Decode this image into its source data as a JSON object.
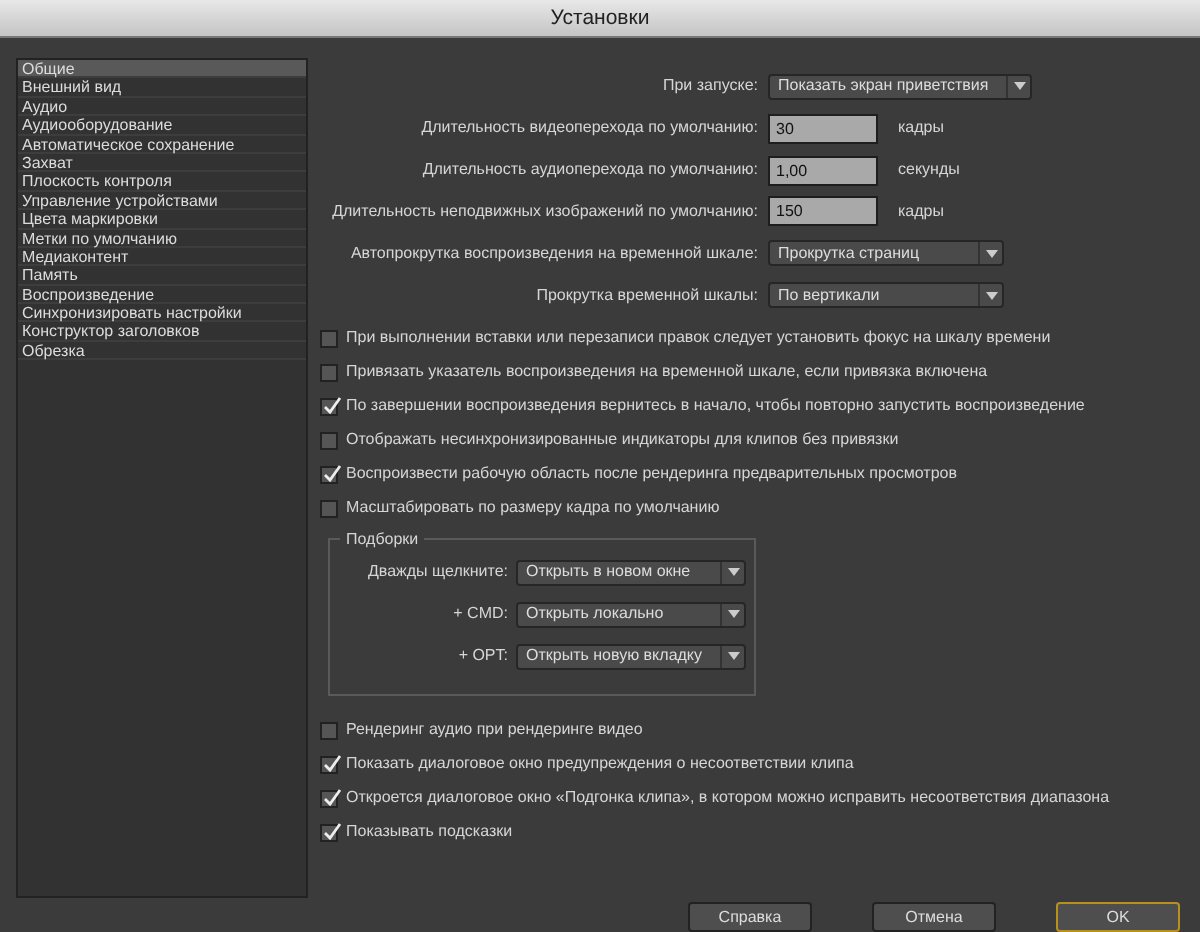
{
  "window": {
    "title": "Установки"
  },
  "sidebar": {
    "items": [
      {
        "label": "Общие",
        "selected": true
      },
      {
        "label": "Внешний вид",
        "selected": false
      },
      {
        "label": "Аудио",
        "selected": false
      },
      {
        "label": "Аудиооборудование",
        "selected": false
      },
      {
        "label": "Автоматическое сохранение",
        "selected": false
      },
      {
        "label": "Захват",
        "selected": false
      },
      {
        "label": "Плоскость контроля",
        "selected": false
      },
      {
        "label": "Управление устройствами",
        "selected": false
      },
      {
        "label": "Цвета маркировки",
        "selected": false
      },
      {
        "label": "Метки по умолчанию",
        "selected": false
      },
      {
        "label": "Медиаконтент",
        "selected": false
      },
      {
        "label": "Память",
        "selected": false
      },
      {
        "label": "Воспроизведение",
        "selected": false
      },
      {
        "label": "Синхронизировать настройки",
        "selected": false
      },
      {
        "label": "Конструктор заголовков",
        "selected": false
      },
      {
        "label": "Обрезка",
        "selected": false
      }
    ]
  },
  "settings": [
    {
      "kind": "dropdown",
      "label": "При запуске:",
      "value": "Показать экран приветствия"
    },
    {
      "kind": "number",
      "label": "Длительность видеоперехода по умолчанию:",
      "value": "30",
      "unit": "кадры"
    },
    {
      "kind": "number",
      "label": "Длительность аудиоперехода по умолчанию:",
      "value": "1,00",
      "unit": "секунды"
    },
    {
      "kind": "number",
      "label": "Длительность неподвижных изображений по умолчанию:",
      "value": "150",
      "unit": "кадры"
    },
    {
      "kind": "dropdown",
      "label": "Автопрокрутка воспроизведения на временной шкале:",
      "value": "Прокрутка страниц"
    },
    {
      "kind": "dropdown",
      "label": "Прокрутка временной шкалы:",
      "value": "По вертикали"
    }
  ],
  "checkboxes": [
    {
      "label": "При выполнении вставки или перезаписи правок следует установить фокус на шкалу времени",
      "checked": false
    },
    {
      "label": "Привязать указатель воспроизведения на временной шкале, если привязка включена",
      "checked": false
    },
    {
      "label": "По завершении воспроизведения вернитесь в начало, чтобы повторно запустить воспроизведение",
      "checked": true
    },
    {
      "label": "Отображать несинхронизированные индикаторы для клипов без привязки",
      "checked": false
    },
    {
      "label": "Воспроизвести рабочую область после рендеринга предварительных просмотров",
      "checked": true
    },
    {
      "label": "Масштабировать по размеру кадра по умолчанию",
      "checked": false
    }
  ],
  "bins": {
    "title": "Подборки",
    "rows": [
      {
        "label": "Дважды щелкните:",
        "value": "Открыть в новом окне"
      },
      {
        "label": "+ CMD:",
        "value": "Открыть локально"
      },
      {
        "label": "+ OPT:",
        "value": "Открыть новую вкладку"
      }
    ]
  },
  "checkboxes_2": [
    {
      "label": "Рендеринг аудио при рендеринге видео",
      "checked": false
    },
    {
      "label": "Показать диалоговое окно предупреждения о несоответствии клипа",
      "checked": true
    },
    {
      "label": "Откроется диалоговое окно «Подгонка клипа», в котором можно исправить несоответствия диапазона",
      "checked": true
    },
    {
      "label": "Показывать подсказки",
      "checked": true
    }
  ],
  "buttons": [
    {
      "label": "Справка",
      "default": false
    },
    {
      "label": "Отмена",
      "default": false
    },
    {
      "label": "OK",
      "default": true
    }
  ]
}
